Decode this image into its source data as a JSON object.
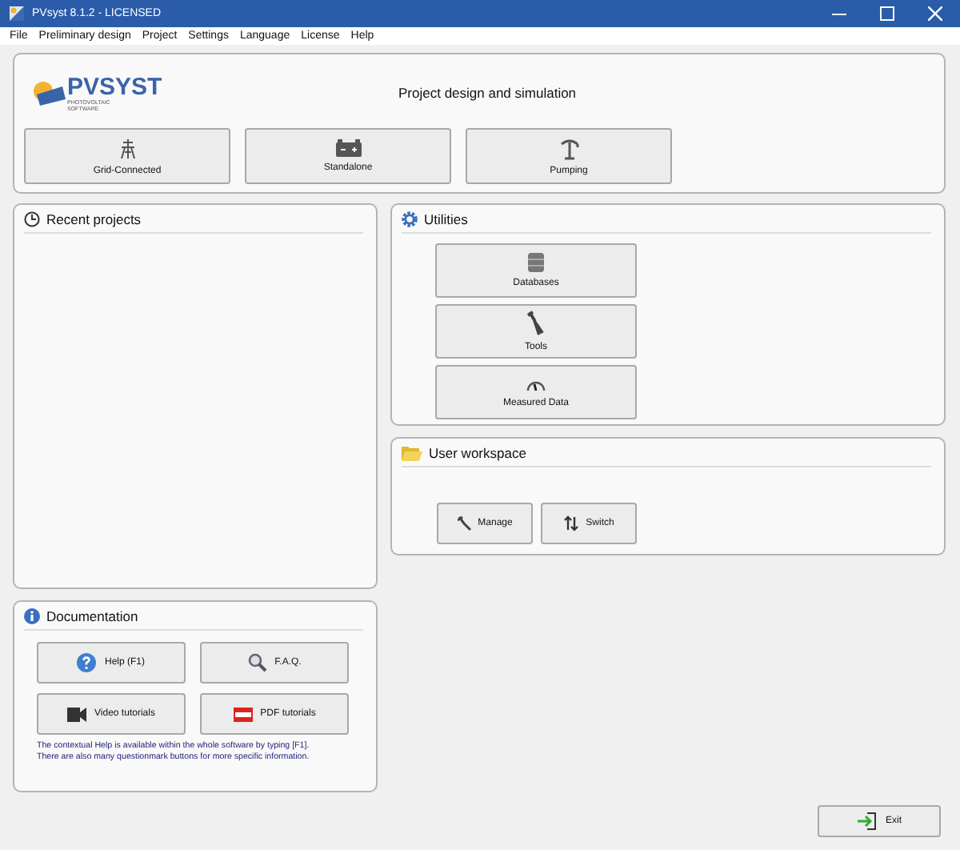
{
  "window": {
    "title": "PVsyst 8.1.2 - LICENSED"
  },
  "menu": [
    "File",
    "Preliminary design",
    "Project",
    "Settings",
    "Language",
    "License",
    "Help"
  ],
  "header": {
    "logo": {
      "name": "PVSYST",
      "tagline_1": "PHOTOVOLTAIC",
      "tagline_2": "SOFTWARE"
    },
    "title": "Project design and simulation",
    "buttons": [
      {
        "label": "Grid-Connected",
        "kind": "tower"
      },
      {
        "label": "Standalone",
        "kind": "battery"
      },
      {
        "label": "Pumping",
        "kind": "pump"
      }
    ]
  },
  "recent_projects": {
    "title": "Recent projects"
  },
  "utilities": {
    "title": "Utilities",
    "buttons": [
      {
        "label": "Databases",
        "kind": "database"
      },
      {
        "label": "Tools",
        "kind": "wrench"
      },
      {
        "label": "Measured Data",
        "kind": "gauge"
      }
    ]
  },
  "user_workspace": {
    "title": "User workspace",
    "buttons": [
      {
        "label": "Manage",
        "kind": "wrench"
      },
      {
        "label": "Switch",
        "kind": "arrows"
      }
    ]
  },
  "documentation": {
    "title": "Documentation",
    "buttons": [
      {
        "label": "Help (F1)",
        "kind": "help"
      },
      {
        "label": "F.A.Q.",
        "kind": "search"
      },
      {
        "label": "Video tutorials",
        "kind": "video"
      },
      {
        "label": "PDF tutorials",
        "kind": "pdf"
      }
    ],
    "note_lines": [
      "The contextual Help is available within the whole software by typing [F1].",
      "There are also many questionmark buttons for more specific information."
    ]
  },
  "exit_button": {
    "label": "Exit"
  }
}
